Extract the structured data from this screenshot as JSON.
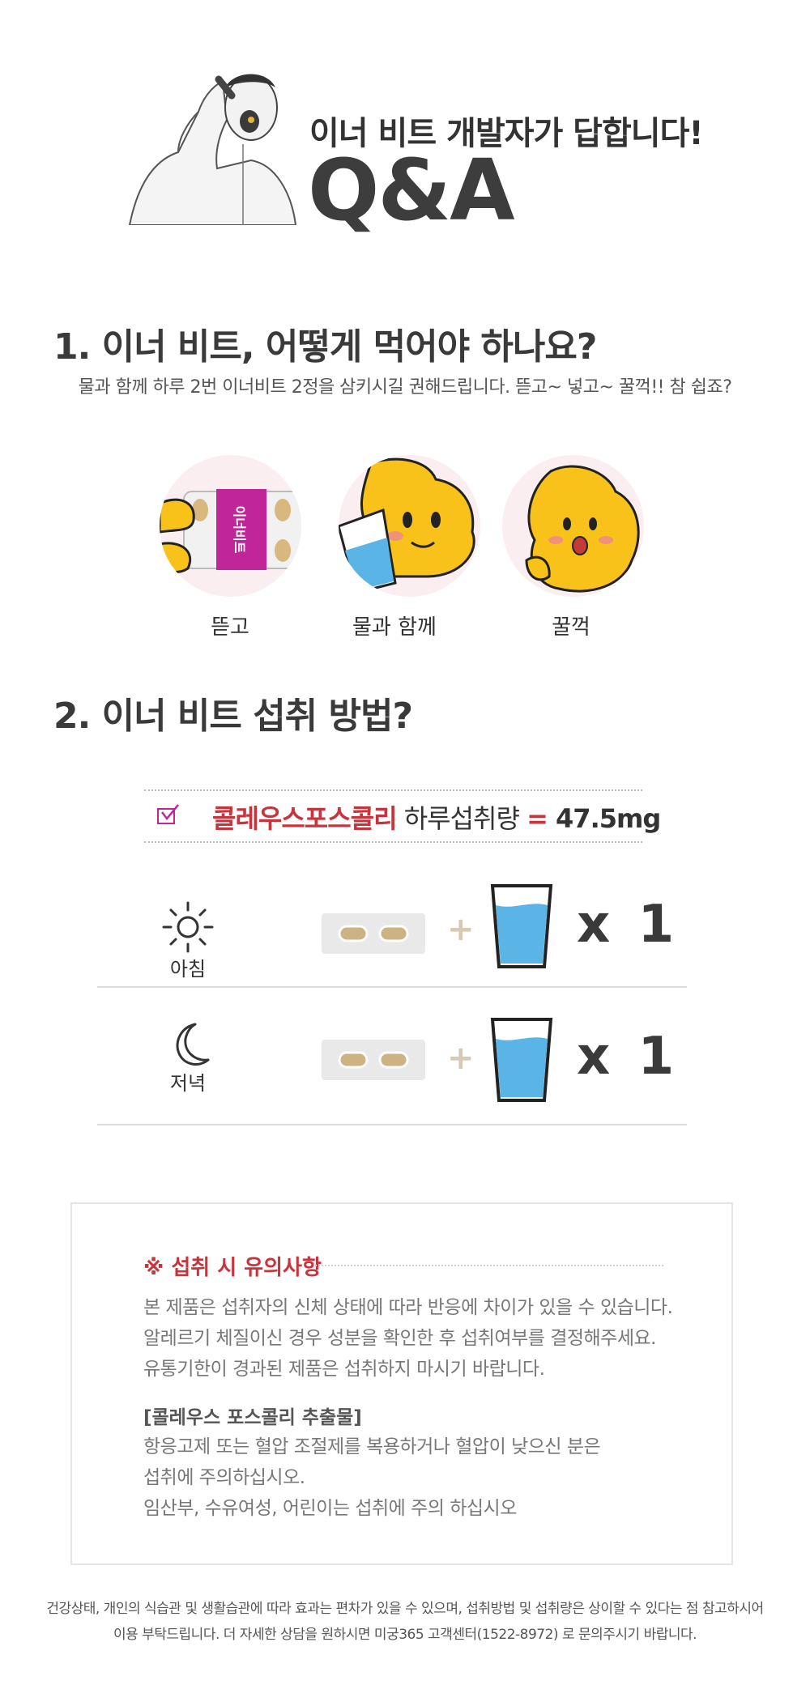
{
  "header": {
    "subtitle": "이너 비트 개발자가 답합니다!",
    "title": "Q&A"
  },
  "q1": {
    "heading": "1. 이너 비트, 어떻게 먹어야 하나요?",
    "description": "물과 함께 하루 2번 이너비트 2정을 삼키시길 권해드립니다. 뜯고~ 넣고~ 꿀꺽!! 참 쉽죠?",
    "steps": [
      {
        "label": "뜯고",
        "icon": "pill-pack-icon"
      },
      {
        "label": "물과 함께",
        "icon": "water-glass-character-icon"
      },
      {
        "label": "꿀꺽",
        "icon": "swallow-character-icon"
      }
    ],
    "package_text": "이너비트"
  },
  "q2": {
    "heading": "2. 이너 비트 섭취 방법?",
    "intake": {
      "ingredient": "콜레우스포스콜리",
      "middle": " 하루섭취량 ",
      "equals": "=",
      "amount": " 47.5mg"
    },
    "schedule": [
      {
        "label": "아침",
        "icon": "sun-icon",
        "plus": "+",
        "times": "x 1"
      },
      {
        "label": "저녁",
        "icon": "moon-icon",
        "plus": "+",
        "times": "x 1"
      }
    ]
  },
  "caution": {
    "title": "※ 섭취 시 유의사항",
    "lines": [
      "본 제품은 섭취자의 신체 상태에 따라 반응에 차이가 있을 수 있습니다.",
      "알레르기 체질이신 경우 성분을 확인한 후 섭취여부를 결정해주세요.",
      "유통기한이 경과된 제품은 섭취하지 마시기 바랍니다."
    ],
    "subheading": "[콜레우스 포스콜리 추출물]",
    "sub_lines": [
      "항응고제 또는 혈압 조절제를 복용하거나 혈압이 낮으신 분은",
      "섭취에 주의하십시오.",
      "임산부, 수유여성, 어린이는 섭취에 주의 하십시오"
    ]
  },
  "footer": {
    "line1": "건강상태, 개인의 식습관 및 생활습관에 따라 효과는 편차가 있을 수 있으며, 섭취방법 및 섭취량은 상이할 수 있다는 점 참고하시어",
    "line2": "이용 부탁드립니다. 더 자세한 상담을 원하시면  미궁365 고객센터(1522-8972) 로 문의주시기 바랍니다."
  },
  "colors": {
    "accent": "#c8343c",
    "heading": "#3a3a3a",
    "character": "#f8c21b",
    "pill_pack": "#c0259a",
    "water": "#5ab4e6"
  }
}
